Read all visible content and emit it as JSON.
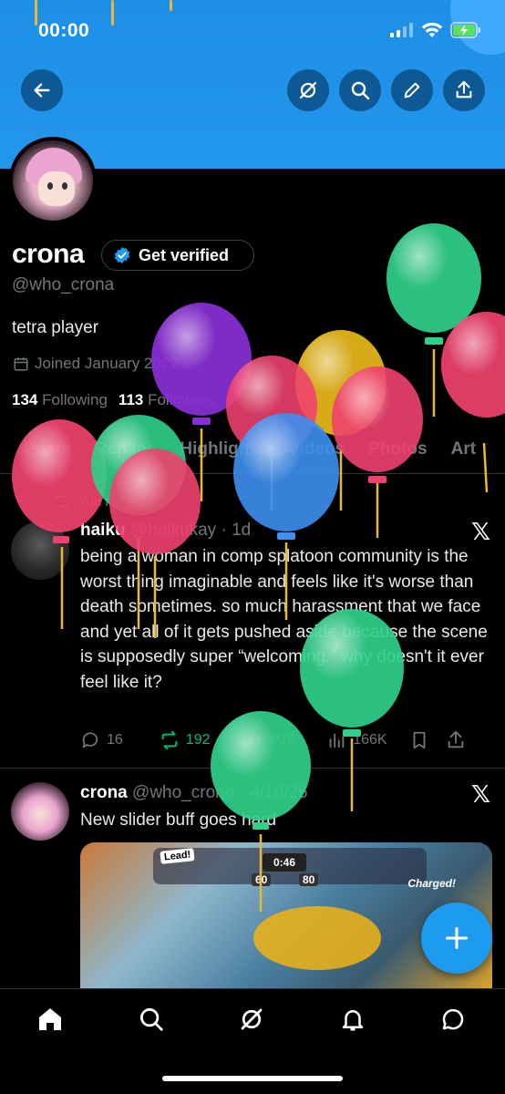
{
  "status": {
    "time": "00:00"
  },
  "header": {
    "back_icon": "arrow-left-icon",
    "actions": [
      "grok-icon",
      "search-icon",
      "edit-icon",
      "share-icon"
    ]
  },
  "profile": {
    "name": "crona",
    "verify_label": "Get verified",
    "handle": "@who_crona",
    "bio": "tetra player",
    "joined": "Joined January 2022",
    "following_count": "134",
    "following_label": "Following",
    "followers_count": "113",
    "followers_label": "Followers"
  },
  "tabs": [
    "Posts",
    "Replies",
    "Highlights",
    "Videos",
    "Photos",
    "Art"
  ],
  "posts": [
    {
      "repost_label": "You reposted",
      "name": "haiku",
      "handle": "@haikukay",
      "time": "· 1d",
      "text": "being a woman in comp splatoon community is the worst thing imaginable and feels like it's worse than death sometimes. so much harassment that we face and yet all of it gets pushed aside because the scene is supposedly super “welcoming.” why doesn't it ever feel like it?",
      "replies": "16",
      "reposts": "192",
      "likes": "926",
      "views": "166K"
    },
    {
      "name": "crona",
      "handle": "@who_crona",
      "time": "· 4/19/26",
      "text": "New slider buff goes hard",
      "media": {
        "lead_tag": "Lead!",
        "timer": "0:46",
        "score_left": "60",
        "score_right": "80",
        "charged": "Charged!"
      }
    }
  ],
  "fab_icon": "plus-icon",
  "bottom_nav": [
    "home-icon",
    "search-icon",
    "grok-icon",
    "bell-icon",
    "messages-icon"
  ],
  "colors": {
    "accent": "#1d9bf0",
    "banner": "#2397ec",
    "repost_green": "#00ba7c",
    "like_pink": "#f91880"
  }
}
